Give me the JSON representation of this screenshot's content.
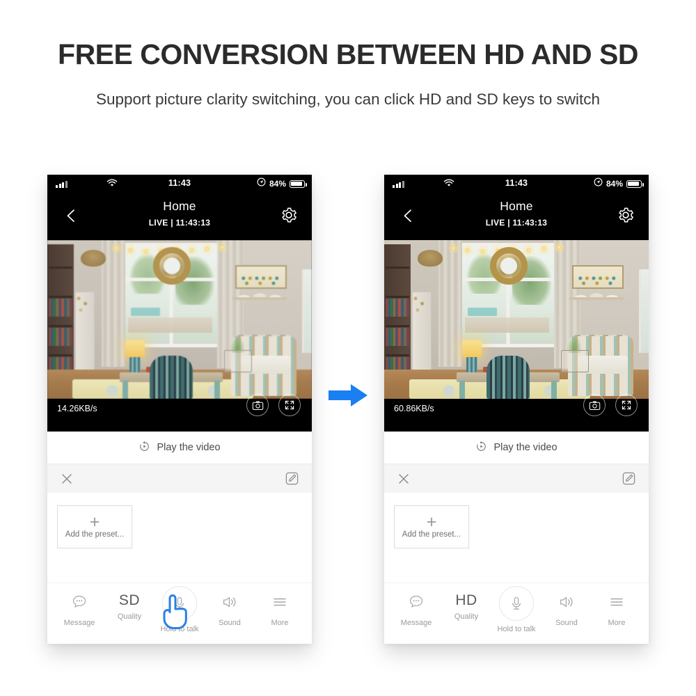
{
  "headline": "FREE CONVERSION BETWEEN HD AND SD",
  "subhead": "Support picture clarity switching, you can click HD and SD keys to switch",
  "arrow": {
    "icon": "arrow-right-icon",
    "color": "#1a7ff0"
  },
  "phones": [
    {
      "id": "phone-sd",
      "status_bar": {
        "signal_icon": "cellular-signal-icon",
        "wifi_icon": "wifi-icon",
        "time": "11:43",
        "location_icon": "location-icon",
        "battery_percent": "84%",
        "battery_icon": "battery-icon"
      },
      "nav": {
        "back_icon": "back-arrow-icon",
        "title": "Home",
        "subtitle": "LIVE | 11:43:13",
        "settings_icon": "gear-icon"
      },
      "video": {
        "bitrate": "14.26KB/s",
        "snapshot_icon": "camera-icon",
        "fullscreen_icon": "fullscreen-icon",
        "quality_mode": "SD"
      },
      "play_row": {
        "icon": "replay-icon",
        "label": "Play the video"
      },
      "preset": {
        "close_icon": "close-icon",
        "edit_icon": "edit-icon",
        "add_plus": "+",
        "add_label": "Add the preset..."
      },
      "toolbar": [
        {
          "icon": "message-icon",
          "label": "Message",
          "value": ""
        },
        {
          "icon": "quality-icon",
          "label": "Quality",
          "value": "SD"
        },
        {
          "icon": "microphone-icon",
          "label": "Hold to talk",
          "value": ""
        },
        {
          "icon": "sound-icon",
          "label": "Sound",
          "value": ""
        },
        {
          "icon": "more-icon",
          "label": "More",
          "value": ""
        }
      ],
      "cursor": {
        "icon": "hand-pointer-icon",
        "color": "#2a7fe8",
        "target": "Quality"
      }
    },
    {
      "id": "phone-hd",
      "status_bar": {
        "signal_icon": "cellular-signal-icon",
        "wifi_icon": "wifi-icon",
        "time": "11:43",
        "location_icon": "location-icon",
        "battery_percent": "84%",
        "battery_icon": "battery-icon"
      },
      "nav": {
        "back_icon": "back-arrow-icon",
        "title": "Home",
        "subtitle": "LIVE | 11:43:13",
        "settings_icon": "gear-icon"
      },
      "video": {
        "bitrate": "60.86KB/s",
        "snapshot_icon": "camera-icon",
        "fullscreen_icon": "fullscreen-icon",
        "quality_mode": "HD"
      },
      "play_row": {
        "icon": "replay-icon",
        "label": "Play the video"
      },
      "preset": {
        "close_icon": "close-icon",
        "edit_icon": "edit-icon",
        "add_plus": "+",
        "add_label": "Add the preset..."
      },
      "toolbar": [
        {
          "icon": "message-icon",
          "label": "Message",
          "value": ""
        },
        {
          "icon": "quality-icon",
          "label": "Quality",
          "value": "HD"
        },
        {
          "icon": "microphone-icon",
          "label": "Hold to talk",
          "value": ""
        },
        {
          "icon": "sound-icon",
          "label": "Sound",
          "value": ""
        },
        {
          "icon": "more-icon",
          "label": "More",
          "value": ""
        }
      ],
      "cursor": null
    }
  ]
}
